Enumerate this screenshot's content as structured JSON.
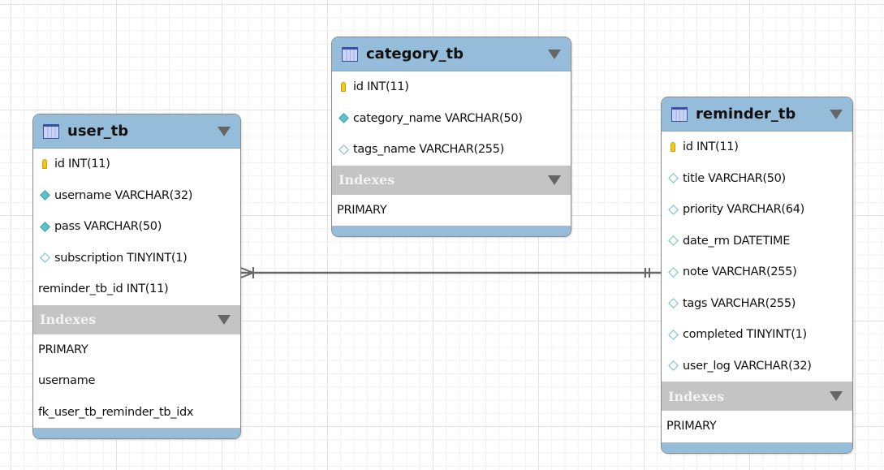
{
  "colors": {
    "header": "#95bdd9",
    "index_header": "#c4c4c4",
    "not_null_icon": "#5cc4c9",
    "key_icon": "#f2c81c",
    "relationship_line": "#666666"
  },
  "tables": [
    {
      "id": "user_tb",
      "name": "user_tb",
      "indexes_label": "Indexes",
      "columns": [
        {
          "text": "id INT(11)",
          "icon": "key"
        },
        {
          "text": "username VARCHAR(32)",
          "icon": "diamond-filled"
        },
        {
          "text": "pass VARCHAR(50)",
          "icon": "diamond-filled"
        },
        {
          "text": "subscription TINYINT(1)",
          "icon": "diamond-hollow"
        },
        {
          "text": "reminder_tb_id INT(11)",
          "icon": "none"
        }
      ],
      "indexes": [
        "PRIMARY",
        "username",
        "fk_user_tb_reminder_tb_idx"
      ]
    },
    {
      "id": "category_tb",
      "name": "category_tb",
      "indexes_label": "Indexes",
      "columns": [
        {
          "text": "id INT(11)",
          "icon": "key"
        },
        {
          "text": "category_name VARCHAR(50)",
          "icon": "diamond-filled"
        },
        {
          "text": "tags_name VARCHAR(255)",
          "icon": "diamond-hollow"
        }
      ],
      "indexes": [
        "PRIMARY"
      ]
    },
    {
      "id": "reminder_tb",
      "name": "reminder_tb",
      "indexes_label": "Indexes",
      "columns": [
        {
          "text": "id INT(11)",
          "icon": "key"
        },
        {
          "text": "title VARCHAR(50)",
          "icon": "diamond-hollow"
        },
        {
          "text": "priority VARCHAR(64)",
          "icon": "diamond-hollow"
        },
        {
          "text": "date_rm DATETIME",
          "icon": "diamond-hollow"
        },
        {
          "text": "note VARCHAR(255)",
          "icon": "diamond-hollow"
        },
        {
          "text": "tags VARCHAR(255)",
          "icon": "diamond-hollow"
        },
        {
          "text": "completed TINYINT(1)",
          "icon": "diamond-hollow"
        },
        {
          "text": "user_log VARCHAR(32)",
          "icon": "diamond-hollow"
        }
      ],
      "indexes": [
        "PRIMARY"
      ]
    }
  ],
  "relationships": [
    {
      "from": "user_tb",
      "to": "reminder_tb",
      "from_cardinality": "many",
      "to_cardinality": "one-and-only-one"
    }
  ]
}
